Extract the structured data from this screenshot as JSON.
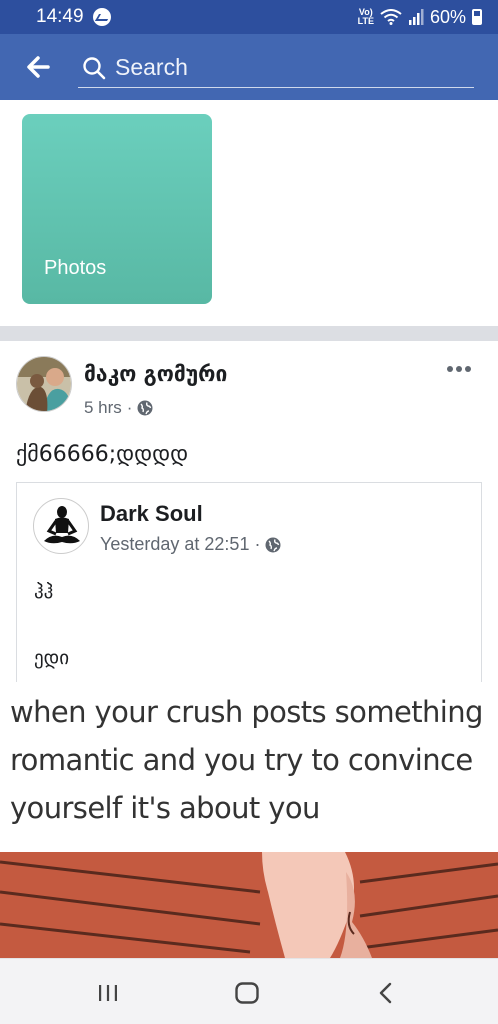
{
  "status_bar": {
    "time": "14:49",
    "network": "Vo) LTE",
    "battery": "60%"
  },
  "header": {
    "search_placeholder": "Search"
  },
  "photos_tile": {
    "label": "Photos"
  },
  "post": {
    "author": "მაკო გომური",
    "time": "5 hrs",
    "separator": "·",
    "text": "ქმ66666;დდდდ",
    "shared": {
      "author": "Dark Soul",
      "time": "Yesterday at 22:51",
      "separator": "·",
      "line1": "ჰჰ",
      "line2": "ედი"
    }
  },
  "meme": {
    "caption": "when your crush posts something romantic and you try to convince yourself it's about you"
  },
  "colors": {
    "status_bar": "#2d4f9e",
    "header": "#4267b2",
    "photos_tile": "#62c4b0",
    "divider": "#dcdee3"
  },
  "icons": [
    "messenger-icon",
    "back-arrow-icon",
    "search-icon",
    "globe-icon",
    "more-icon",
    "recent-apps-icon",
    "home-icon",
    "back-icon"
  ]
}
